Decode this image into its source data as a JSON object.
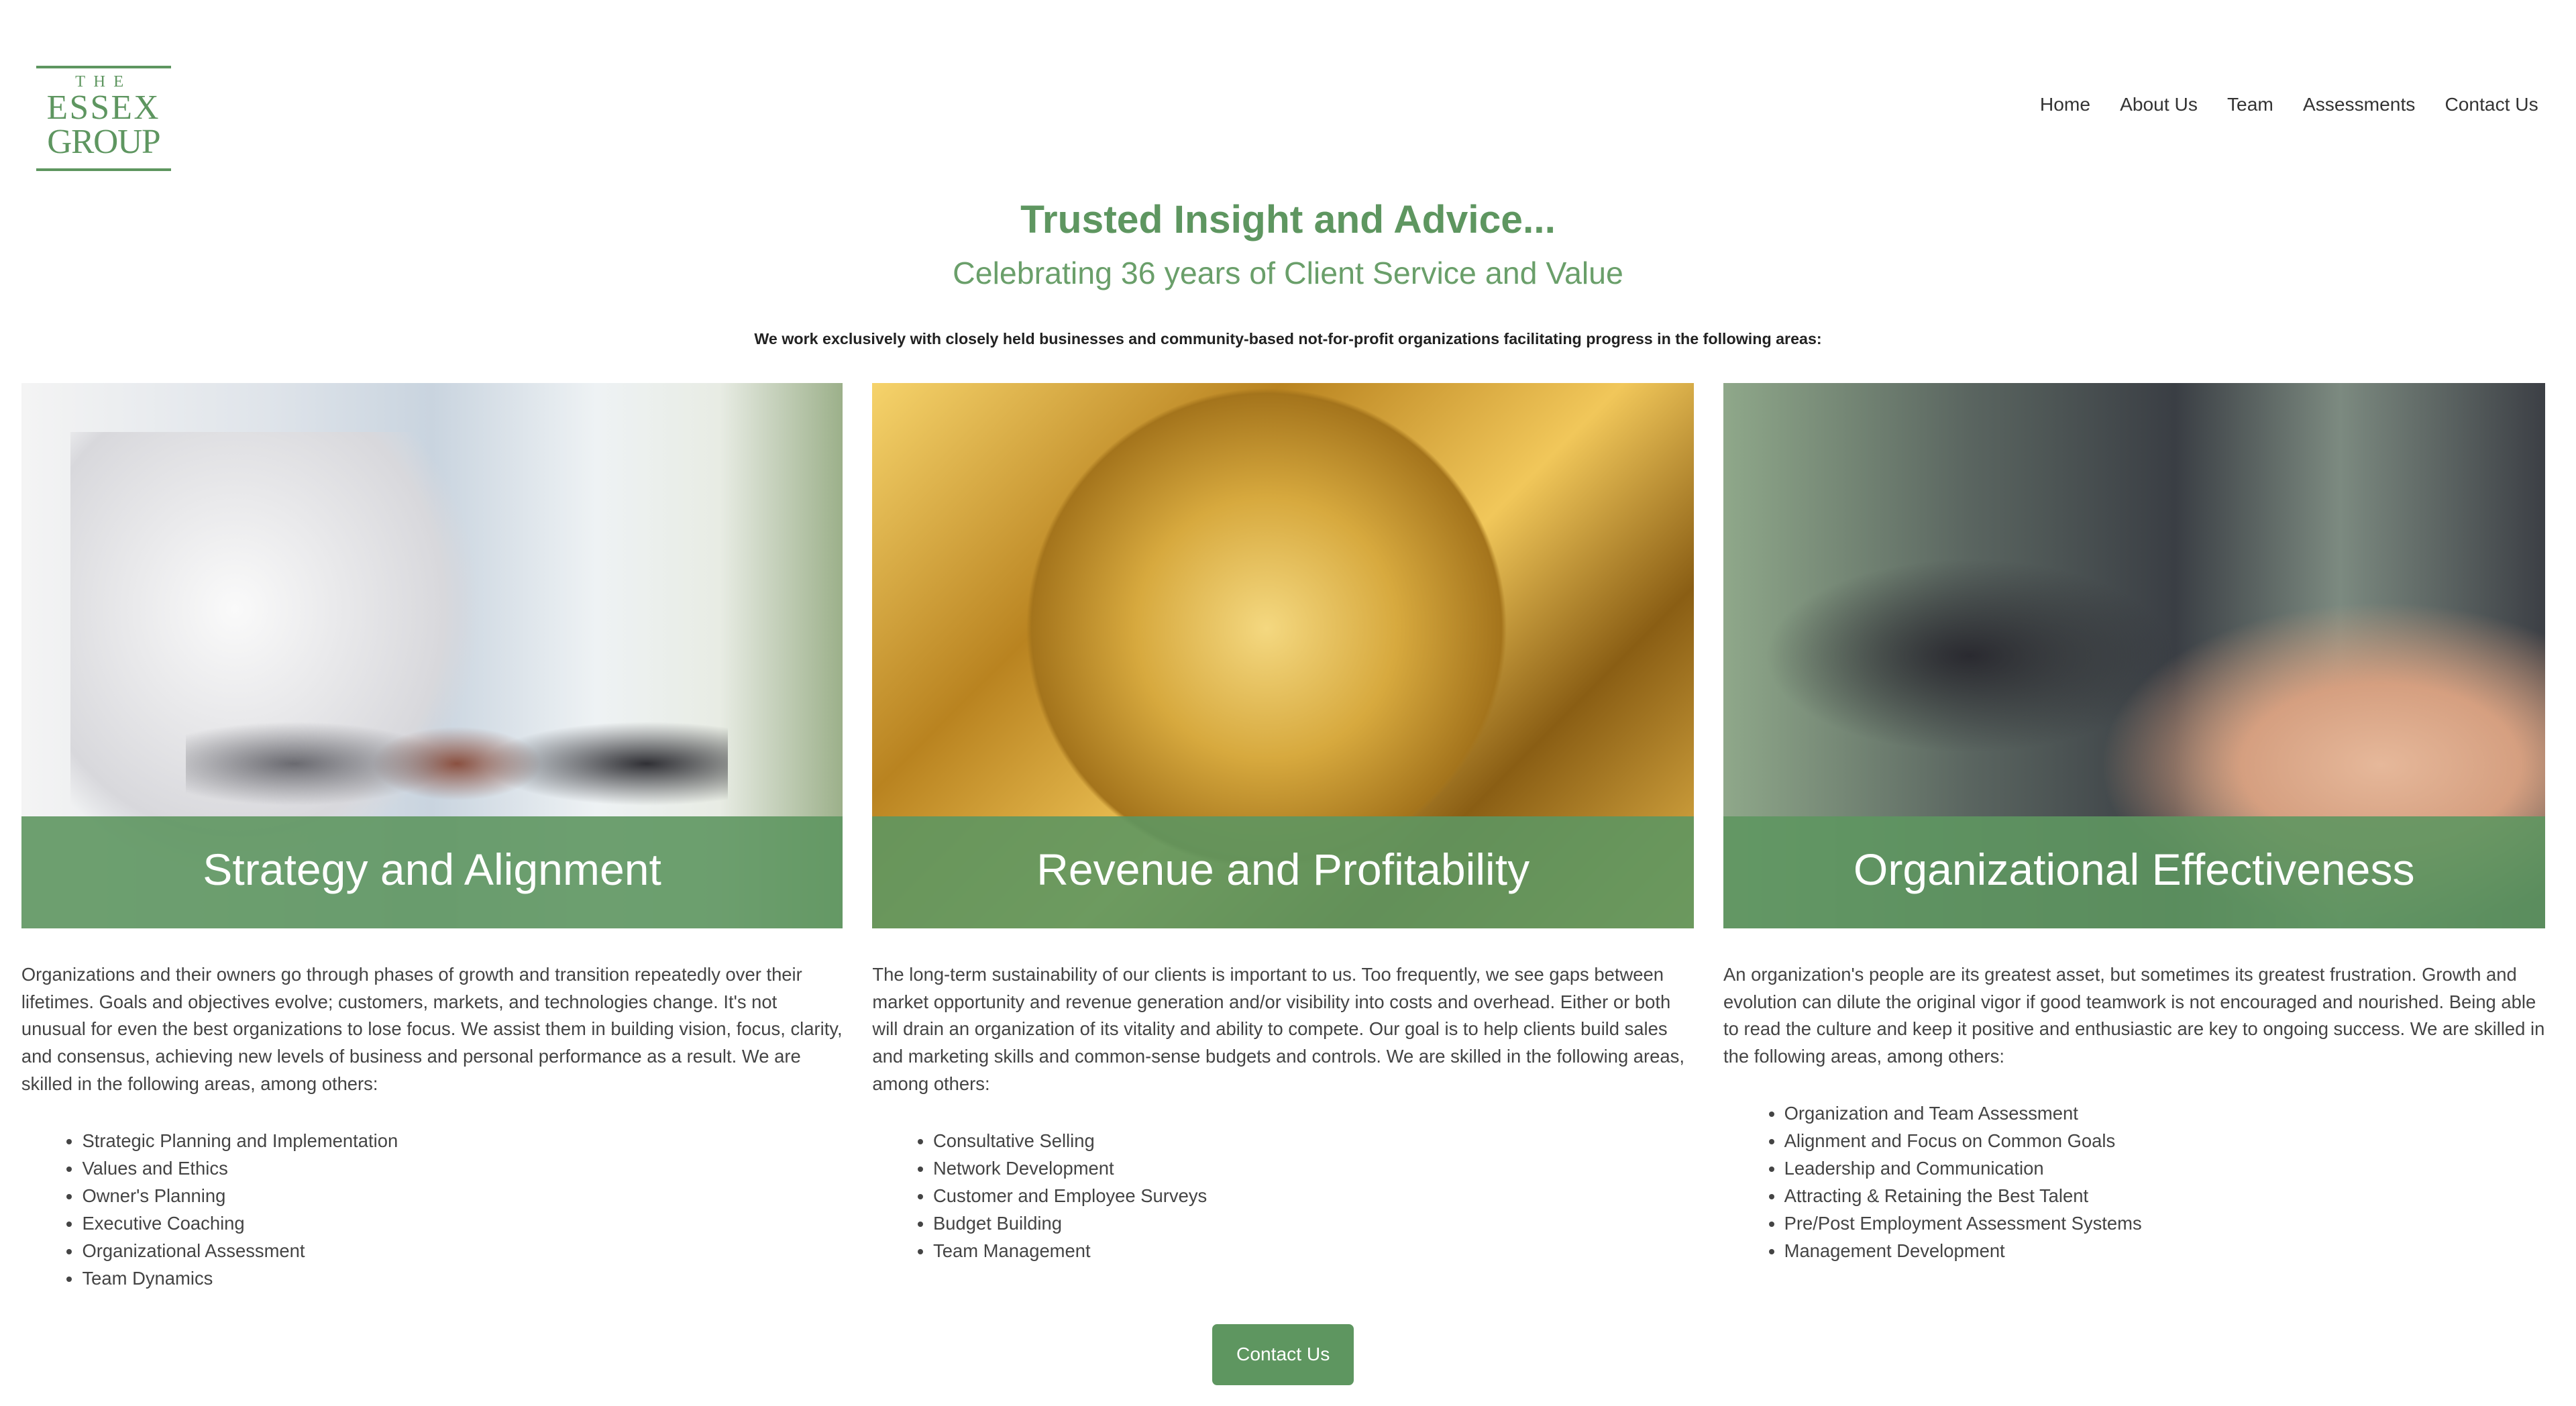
{
  "logo": {
    "line1": "THE",
    "line2": "ESSEX",
    "line3": "GROUP"
  },
  "nav": [
    "Home",
    "About Us",
    "Team",
    "Assessments",
    "Contact Us"
  ],
  "hero": {
    "title": "Trusted Insight and Advice...",
    "subtitle": "Celebrating 36 years of Client Service and Value",
    "intro": "We work exclusively with closely held businesses and community-based not-for-profit organizations facilitating progress in the following areas:"
  },
  "columns": [
    {
      "caption": "Strategy and Alignment",
      "text": "Organizations and their owners go through phases of growth and transition repeatedly over their lifetimes.  Goals and objectives evolve; customers, markets, and technologies change.  It's not unusual for even the best organizations to lose focus.   We assist them in building vision, focus, clarity, and consensus, achieving new levels of business and personal performance as a result.  We are skilled in the following areas, among others:",
      "items": [
        "Strategic Planning and Implementation",
        "Values and Ethics",
        "Owner's Planning",
        "Executive Coaching",
        "Organizational Assessment",
        "Team Dynamics"
      ]
    },
    {
      "caption": "Revenue and Profitability",
      "text": "The long-term sustainability of our clients is important to us.  Too frequently, we see gaps between market opportunity and revenue generation and/or visibility into costs and overhead.  Either or both will drain an organization of its vitality and ability to compete.  Our goal is to help clients build sales and marketing skills and common-sense budgets and controls.  We are skilled in the following areas, among others:",
      "items": [
        "Consultative Selling",
        "Network Development",
        "Customer and Employee Surveys",
        "Budget Building",
        "Team Management"
      ]
    },
    {
      "caption": "Organizational Effectiveness",
      "text": "An organization's people are its greatest asset, but sometimes its greatest frustration.  Growth and evolution can dilute the original vigor if good teamwork is not encouraged and nourished.  Being able to read the culture and keep it positive and enthusiastic are key to ongoing success.  We are skilled in the following areas, among others:",
      "items": [
        "Organization and Team Assessment",
        "Alignment and Focus on Common Goals",
        "Leadership and Communication",
        "Attracting & Retaining the Best Talent",
        "Pre/Post Employment Assessment Systems",
        "Management Development"
      ]
    }
  ],
  "cta": "Contact Us",
  "colors": {
    "brand": "#5e9660"
  }
}
